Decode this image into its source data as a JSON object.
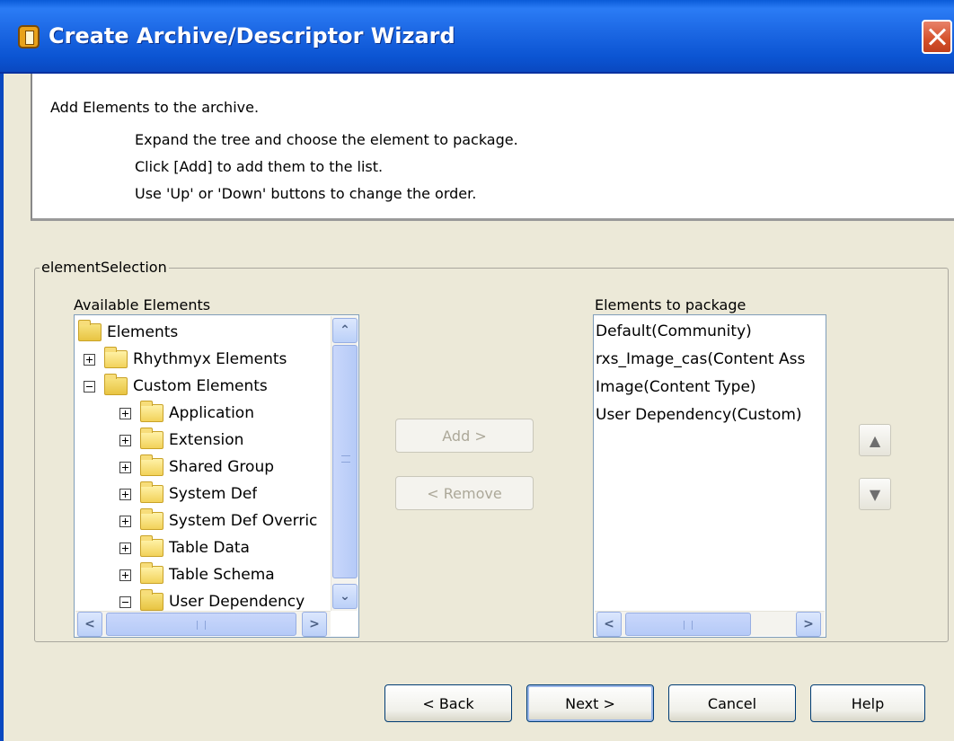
{
  "window": {
    "title": "Create Archive/Descriptor Wizard"
  },
  "instructions": {
    "heading": "Add Elements to the archive.",
    "lines": [
      "Expand the tree and choose the element to package.",
      "Click [Add] to add them to the list.",
      "Use 'Up' or 'Down' buttons to change the order."
    ]
  },
  "group": {
    "label": "elementSelection"
  },
  "available": {
    "label": "Available Elements",
    "tree": [
      {
        "label": "Elements",
        "state": "open"
      },
      {
        "label": "Rhythmyx Elements",
        "state": "collapsed"
      },
      {
        "label": "Custom Elements",
        "state": "expanded"
      },
      {
        "label": "Application",
        "state": "collapsed"
      },
      {
        "label": "Extension",
        "state": "collapsed"
      },
      {
        "label": "Shared Group",
        "state": "collapsed"
      },
      {
        "label": "System Def",
        "state": "collapsed"
      },
      {
        "label": "System Def Overric",
        "state": "collapsed"
      },
      {
        "label": "Table Data",
        "state": "collapsed"
      },
      {
        "label": "Table Schema",
        "state": "collapsed"
      },
      {
        "label": "User Dependency",
        "state": "expanded"
      }
    ]
  },
  "middle": {
    "add_label": "Add >",
    "remove_label": "< Remove"
  },
  "package": {
    "label": "Elements to package",
    "items": [
      "Default(Community)",
      "rxs_Image_cas(Content Ass",
      "Image(Content Type)",
      "User Dependency(Custom)"
    ]
  },
  "order": {
    "up_icon": "▲",
    "down_icon": "▼"
  },
  "footer": {
    "back": "< Back",
    "next": "Next >",
    "cancel": "Cancel",
    "help": "Help"
  },
  "scroll_glyphs": {
    "up": "⌃",
    "down": "⌄",
    "left": "<",
    "right": ">"
  },
  "colors": {
    "titlebar": "#0A5BD8",
    "close": "#D4502A",
    "window_bg": "#ECE9D8",
    "scrollbar": "#BBD0F8"
  }
}
